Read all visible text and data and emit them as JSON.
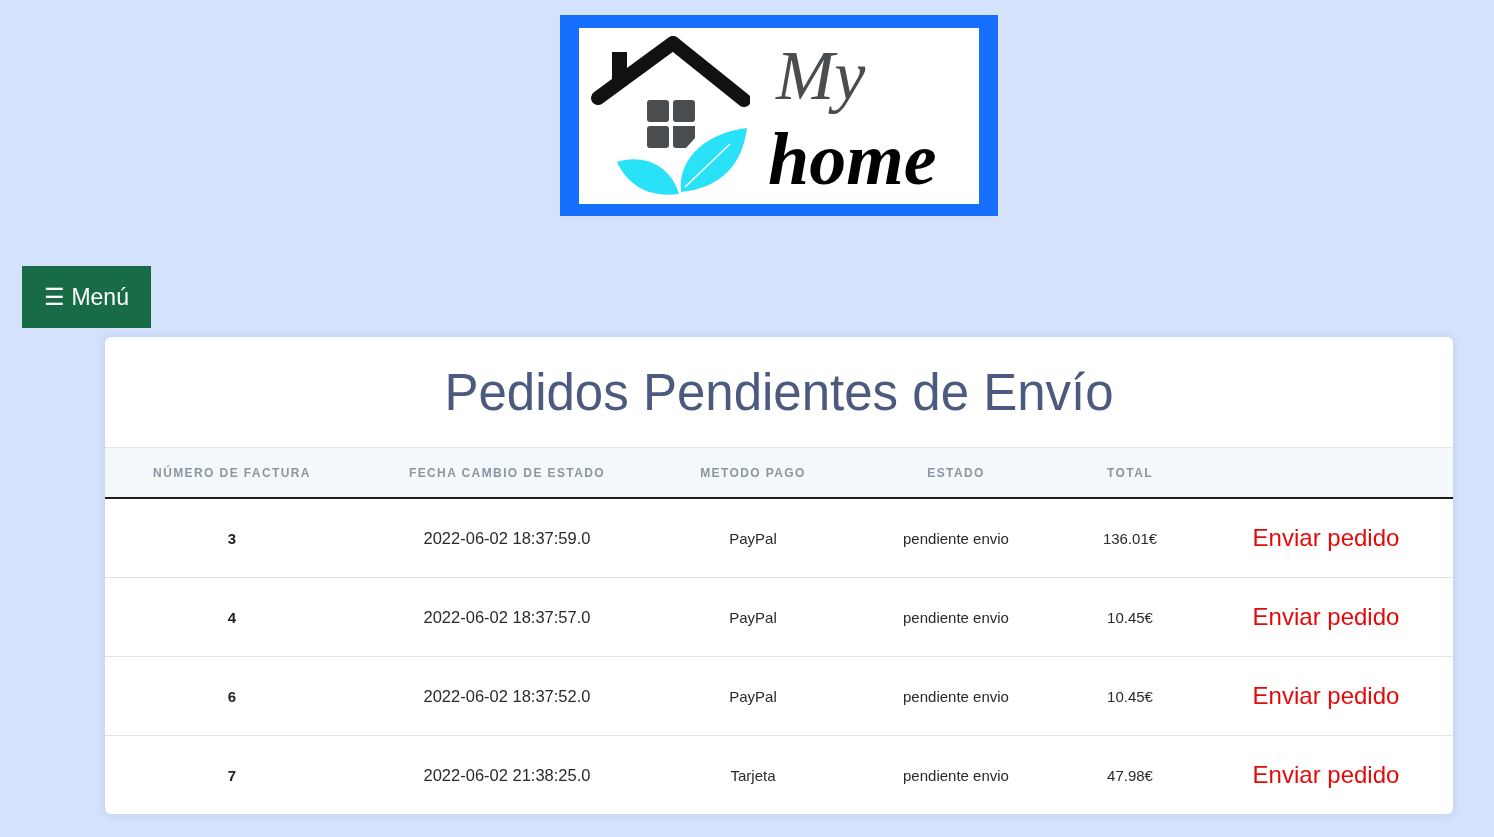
{
  "logo": {
    "line_1": "My",
    "line_2": "home"
  },
  "menu_button": {
    "label": "☰ Menú"
  },
  "orders_card": {
    "title": "Pedidos Pendientes de Envío",
    "table": {
      "columns": [
        "NÚMERO DE FACTURA",
        "FECHA CAMBIO DE ESTADO",
        "METODO PAGO",
        "ESTADO",
        "TOTAL"
      ],
      "rows": [
        {
          "invoice_number": "3",
          "status_changed": "2022-06-02 18:37:59.0",
          "payment_method": "PayPal",
          "status": "pendiente envio",
          "total": "136.01€",
          "action": "Enviar pedido"
        },
        {
          "invoice_number": "4",
          "status_changed": "2022-06-02 18:37:57.0",
          "payment_method": "PayPal",
          "status": "pendiente envio",
          "total": "10.45€",
          "action": "Enviar pedido"
        },
        {
          "invoice_number": "6",
          "status_changed": "2022-06-02 18:37:52.0",
          "payment_method": "PayPal",
          "status": "pendiente envio",
          "total": "10.45€",
          "action": "Enviar pedido"
        },
        {
          "invoice_number": "7",
          "status_changed": "2022-06-02 21:38:25.0",
          "payment_method": "Tarjeta",
          "status": "pendiente envio",
          "total": "47.98€",
          "action": "Enviar pedido"
        }
      ]
    }
  }
}
